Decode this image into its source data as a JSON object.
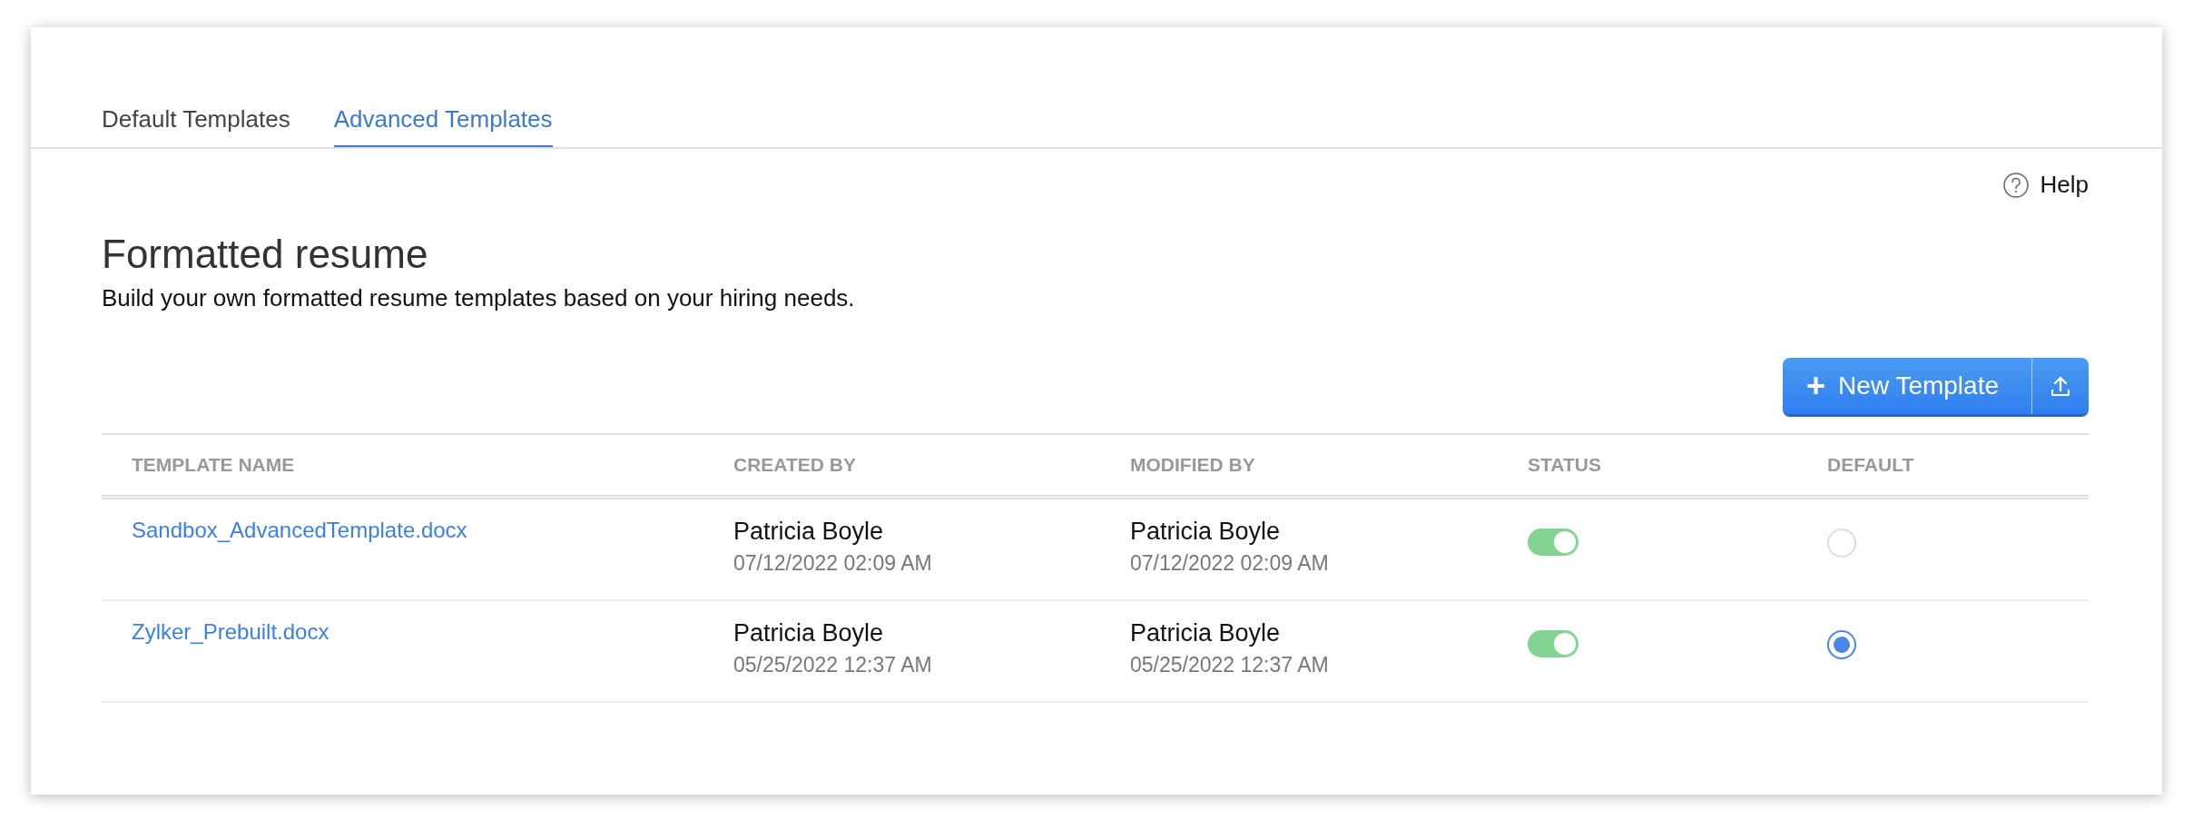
{
  "tabs": [
    {
      "label": "Default Templates",
      "selected": false
    },
    {
      "label": "Advanced Templates",
      "selected": true
    }
  ],
  "help": {
    "label": "Help"
  },
  "heading": "Formatted resume",
  "description": "Build your own formatted resume templates based on your hiring needs.",
  "new_template_button": {
    "label": "New Template",
    "icon": "+"
  },
  "table": {
    "columns": [
      "TEMPLATE NAME",
      "CREATED BY",
      "MODIFIED BY",
      "STATUS",
      "DEFAULT"
    ],
    "rows": [
      {
        "name": "Sandbox_AdvancedTemplate.docx",
        "created_by": "Patricia Boyle",
        "created_at": "07/12/2022 02:09 AM",
        "modified_by": "Patricia Boyle",
        "modified_at": "07/12/2022 02:09 AM",
        "status_on": true,
        "default_selected": false
      },
      {
        "name": "Zylker_Prebuilt.docx",
        "created_by": "Patricia Boyle",
        "created_at": "05/25/2022 12:37 AM",
        "modified_by": "Patricia Boyle",
        "modified_at": "05/25/2022 12:37 AM",
        "status_on": true,
        "default_selected": true
      }
    ]
  }
}
